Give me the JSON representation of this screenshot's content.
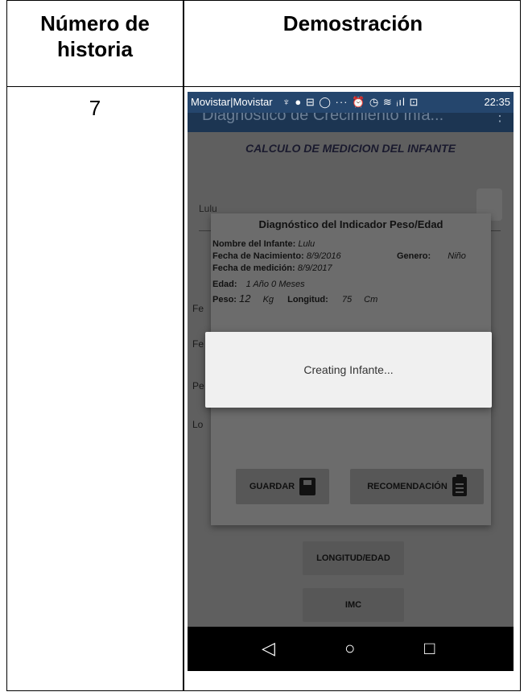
{
  "table": {
    "col1_header": "Número de historia",
    "col2_header": "Demostración",
    "story_number": "7"
  },
  "phone": {
    "statusbar": {
      "carrier": "Movistar|Movistar",
      "icons": "♆ ● ⊟ ◯ ··· ⏰ ◷ ≋ ᵢıl ⊡",
      "time": "22:35"
    },
    "appbar": {
      "title": "Diagnostico de Crecimiento Infa...",
      "menu": "⋮"
    },
    "background": {
      "title": "CALCULO DE MEDICION DEL INFANTE",
      "name_value": "Lulu",
      "labels": [
        "Fe",
        "Fe",
        "Pe",
        "Lo"
      ]
    },
    "dialog": {
      "title": "Diagnóstico del Indicador Peso/Edad",
      "name_label": "Nombre del Infante:",
      "name_value": "Lulu",
      "birth_label": "Fecha de Nacimiento:",
      "birth_value": "8/9/2016",
      "gender_label": "Genero:",
      "gender_value": "Niño",
      "measure_label": "Fecha de medición:",
      "measure_value": "8/9/2017",
      "age_label": "Edad:",
      "age_value": "1 Año 0 Meses",
      "weight_label": "Peso:",
      "weight_value": "12",
      "weight_unit": "Kg",
      "length_label": "Longitud:",
      "length_value": "75",
      "length_unit": "Cm",
      "save_label": "GUARDAR",
      "recommend_label": "RECOMENDACIÓN"
    },
    "progress": {
      "message": "Creating Infante..."
    },
    "buttons": {
      "length_age": "LONGITUD/EDAD",
      "imc": "IMC"
    },
    "navbar": {
      "back": "◁",
      "home": "○",
      "recents": "□"
    }
  }
}
